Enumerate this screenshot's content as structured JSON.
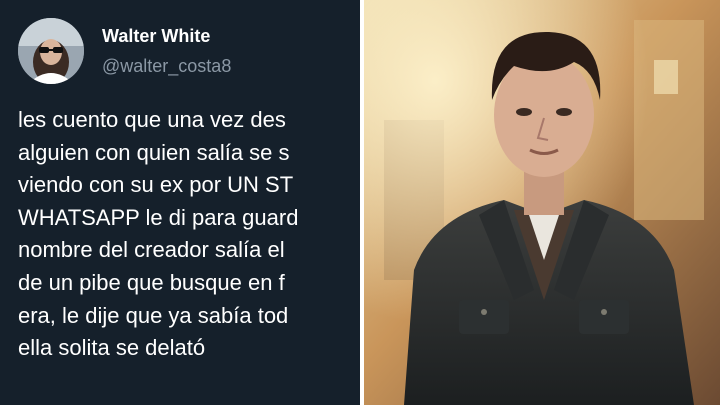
{
  "tweet": {
    "author_name": "Walter White",
    "handle": "@walter_costa8",
    "lines": [
      "les cuento que una vez des",
      "alguien con quien salía se s",
      "viendo con su ex por UN ST",
      "WHATSAPP le di para guard",
      "nombre del creador salía el",
      "de un pibe que busque en f",
      "era, le dije que ya sabía tod",
      "ella solita se delató"
    ]
  },
  "photo": {
    "subject": "man in dark denim jacket over plaid shirt in warm sunlit street"
  },
  "colors": {
    "tweet_background": "#15202b",
    "text_primary": "#ffffff",
    "text_secondary": "#8b98a5"
  }
}
